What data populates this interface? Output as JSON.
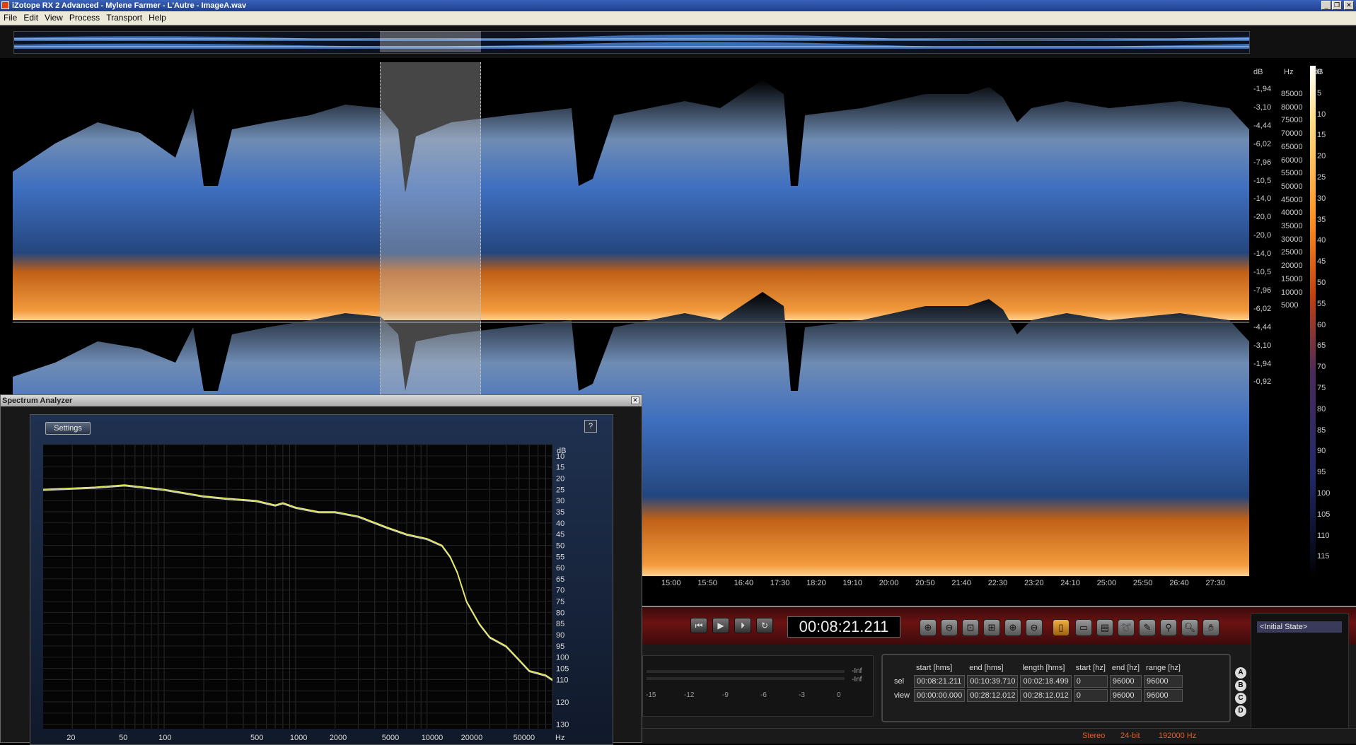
{
  "window": {
    "title": "iZotope RX 2 Advanced - Mylene Farmer - L'Autre - ImageA.wav"
  },
  "menu": [
    "File",
    "Edit",
    "View",
    "Process",
    "Transport",
    "Help"
  ],
  "spectrogram": {
    "db_label": "dB",
    "hz_label": "Hz",
    "db_ticks": [
      "-1,94",
      "-3,10",
      "-4,44",
      "-6,02",
      "-7,96",
      "-10,5",
      "-14,0",
      "-20,0",
      "-20,0",
      "-14,0",
      "-10,5",
      "-7,96",
      "-6,02",
      "-4,44",
      "-3,10",
      "-1,94",
      "-0,92"
    ],
    "hz_ticks": [
      "85000",
      "80000",
      "75000",
      "70000",
      "65000",
      "60000",
      "55000",
      "50000",
      "45000",
      "40000",
      "35000",
      "30000",
      "25000",
      "20000",
      "15000",
      "10000",
      "5000"
    ],
    "colorbar_label": "dB",
    "colorbar_ticks": [
      "0",
      "5",
      "10",
      "15",
      "20",
      "25",
      "30",
      "35",
      "40",
      "45",
      "50",
      "55",
      "60",
      "65",
      "70",
      "75",
      "80",
      "85",
      "90",
      "95",
      "100",
      "105",
      "110",
      "115"
    ],
    "time_ticks": [
      "15:00",
      "15:50",
      "16:40",
      "17:30",
      "18:20",
      "19:10",
      "20:00",
      "20:50",
      "21:40",
      "22:30",
      "23:20",
      "24:10",
      "25:00",
      "25:50",
      "26:40",
      "27:30"
    ]
  },
  "transport": {
    "timecode": "00:08:21.211"
  },
  "meter": {
    "ticks": [
      "-15",
      "-12",
      "-9",
      "-6",
      "-3",
      "0"
    ],
    "peak_l": "-Inf",
    "peak_r": "-Inf"
  },
  "selection": {
    "headers": [
      "start [hms]",
      "end [hms]",
      "length [hms]",
      "start [hz]",
      "end [hz]",
      "range [hz]"
    ],
    "rows": [
      {
        "label": "sel",
        "values": [
          "00:08:21.211",
          "00:10:39.710",
          "00:02:18.499",
          "0",
          "96000",
          "96000"
        ]
      },
      {
        "label": "view",
        "values": [
          "00:00:00.000",
          "00:28:12.012",
          "00:28:12.012",
          "0",
          "96000",
          "96000"
        ]
      }
    ]
  },
  "history": {
    "state": "<Initial State>"
  },
  "compare": [
    "A",
    "B",
    "C",
    "D"
  ],
  "status": {
    "channels": "Stereo",
    "bitdepth": "24-bit",
    "samplerate": "192000 Hz"
  },
  "analyzer": {
    "title": "Spectrum Analyzer",
    "settings_label": "Settings",
    "help_label": "?",
    "db_unit": "dB",
    "hz_unit": "Hz",
    "db_ticks": [
      10,
      15,
      20,
      25,
      30,
      35,
      40,
      45,
      50,
      55,
      60,
      65,
      70,
      75,
      80,
      85,
      90,
      95,
      100,
      105,
      110,
      120,
      130
    ],
    "hz_ticks": [
      "20",
      "50",
      "100",
      "500",
      "1000",
      "2000",
      "5000",
      "10000",
      "20000",
      "50000"
    ],
    "hz_tick_values": [
      20,
      50,
      100,
      500,
      1000,
      2000,
      5000,
      10000,
      20000,
      50000
    ],
    "curve_color": "#e8f050",
    "curve2_color": "#d0d0d0",
    "curve": [
      [
        12,
        25
      ],
      [
        30,
        24
      ],
      [
        50,
        23
      ],
      [
        100,
        25
      ],
      [
        200,
        28
      ],
      [
        300,
        29
      ],
      [
        500,
        30
      ],
      [
        700,
        32
      ],
      [
        800,
        31
      ],
      [
        1000,
        33
      ],
      [
        1500,
        35
      ],
      [
        2000,
        35
      ],
      [
        3000,
        37
      ],
      [
        5000,
        42
      ],
      [
        7000,
        45
      ],
      [
        10000,
        47
      ],
      [
        13000,
        50
      ],
      [
        15000,
        55
      ],
      [
        17000,
        62
      ],
      [
        20000,
        75
      ],
      [
        25000,
        85
      ],
      [
        30000,
        91
      ],
      [
        40000,
        95
      ],
      [
        50000,
        101
      ],
      [
        60000,
        106
      ],
      [
        80000,
        108
      ],
      [
        90000,
        110
      ]
    ]
  }
}
